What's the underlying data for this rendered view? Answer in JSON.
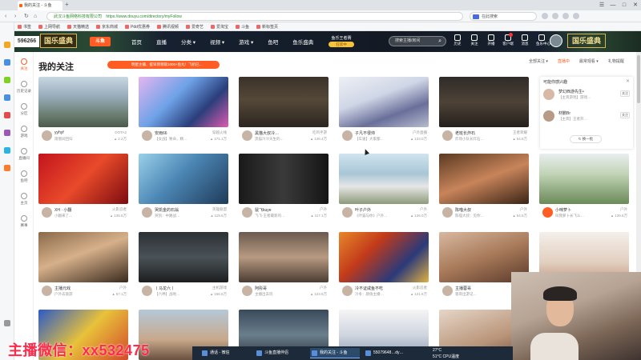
{
  "browser": {
    "tab_title": "我的关注 - 斗鱼",
    "new_tab": "+",
    "window_controls": [
      "☰",
      "—",
      "□",
      "✕"
    ],
    "nav_buttons": [
      "‹",
      "›",
      "↻",
      "⌂"
    ],
    "site_name": "武汉斗鱼网络科技有限公司",
    "url": "https://www.douyu.com/directory/myFollow",
    "search_placeholder": "在此搜索",
    "bookmarks": [
      "书签",
      "上网导航",
      "天猫精选",
      "京东商城",
      "Pdd优惠券",
      "腾讯视频",
      "爱奇艺",
      "爱淘宝",
      "斗鱼",
      "新标签页"
    ]
  },
  "header": {
    "logo_number": "596266",
    "logo_text": "国乐盛典",
    "brand": "斗鱼",
    "nav": [
      "首页",
      "直播",
      "分类 ▾",
      "视频 ▾",
      "游戏 ▾",
      "鱼吧",
      "鱼乐盛典"
    ],
    "promo_text": "鱼乐王者赛",
    "promo_button": "狂欢中",
    "search_placeholder": "搜索主播/房间",
    "search_icon": "⌕",
    "icons": [
      "历史",
      "关注",
      "开播",
      "客户端",
      "消息",
      "鱼乐中心"
    ],
    "right_logo": "国乐盛典"
  },
  "left_nav": [
    {
      "label": "关注",
      "icon": "heart-icon"
    },
    {
      "label": "历史记录",
      "icon": "clock-icon"
    },
    {
      "label": "分区",
      "icon": "grid-icon"
    },
    {
      "label": "游戏",
      "icon": "gamepad-icon"
    },
    {
      "label": "直播间",
      "icon": "tv-icon"
    },
    {
      "label": "鱼吧",
      "icon": "fish-icon"
    },
    {
      "label": "主页",
      "icon": "home-icon"
    },
    {
      "label": "赛事",
      "icon": "trophy-icon"
    }
  ],
  "main": {
    "title": "我的关注",
    "notice": "明星主播，提早到领取1000+鱼丸！飞机已…",
    "filters": [
      "全部关注 ▾",
      "直播中",
      "最常观看 ▾",
      "礼物提醒"
    ],
    "cards": [
      {
        "name": "yyhyf",
        "category": "DOTA2",
        "title": "雨僧间回归",
        "heat": "2.2万"
      },
      {
        "name": "安雨66",
        "category": "穿越火线",
        "title": "【女战】致命，精…",
        "heat": "171.1万"
      },
      {
        "name": "黑猫大叔冷…",
        "category": "吃鸡手游",
        "title": "黑猫冷冷天生的…",
        "heat": "126.4万"
      },
      {
        "name": "子凡不很帅",
        "category": "户外直播",
        "title": "【车速】大家都…",
        "heat": "123.0万"
      },
      {
        "name": "老班长炸石",
        "category": "王者荣耀",
        "title": "炸场小队长炸石…",
        "heat": "54.6万"
      },
      {
        "name": "XH · 小翻",
        "category": "火影忍者",
        "title": "小翻来了…",
        "heat": "136.6万"
      },
      {
        "name": "哭凯金的石翁",
        "category": "英雄联盟",
        "title": "哭凯：中路战…",
        "heat": "119.6万"
      },
      {
        "name": "鼠飞kuye",
        "category": "户外",
        "title": "飞飞·王者最新的…",
        "heat": "117.1万"
      },
      {
        "name": "叶子户外",
        "category": "户外",
        "title": "《叶猫与你》户外…",
        "heat": "126.0万"
      },
      {
        "name": "陈喵大叔",
        "category": "户外",
        "title": "陈喵大叔：见你…",
        "heat": "54.5万"
      },
      {
        "name": "小咪萝卜",
        "category": "户外",
        "title": "叫我萝卜长飞么…",
        "heat": "139.6万"
      },
      {
        "name": "主播元戏",
        "category": "户外",
        "title": "户外去旅游",
        "heat": "67.1万"
      },
      {
        "name": "丨马龙六丨",
        "category": "主机游戏",
        "title": "【六神】战地…",
        "heat": "156.5万"
      },
      {
        "name": "阿彤哥",
        "category": "户外",
        "title": "主播出去玩",
        "heat": "123.6万"
      },
      {
        "name": "冷不证咸鱼不吃",
        "category": "火影忍者",
        "title": "冷冬：颜值主播…",
        "heat": "121.6万"
      },
      {
        "name": "主播蓉哥",
        "category": "户外",
        "title": "蓉哥出游记…",
        "heat": "138.6万"
      }
    ],
    "recommend": {
      "head": "可能你感兴趣",
      "close": "✕",
      "items": [
        {
          "name": "梦幻西游先生•",
          "desc": "【主宾游戏】游戏…",
          "follow": "关注"
        },
        {
          "name": "材鹏Br",
          "desc": "【主宾】王者开…",
          "follow": "关注"
        }
      ],
      "refresh": "↻ 换一批"
    }
  },
  "taskbar": {
    "tasks": [
      "通话 - 微信",
      "斗鱼直播伴侣",
      "我的关注 - 斗鱼",
      "55079648…dy…"
    ],
    "tray_temp": "27°C",
    "tray_cpu": "51°C CPU温度"
  },
  "overlay": {
    "watermark": "主播微信：xx532475"
  }
}
